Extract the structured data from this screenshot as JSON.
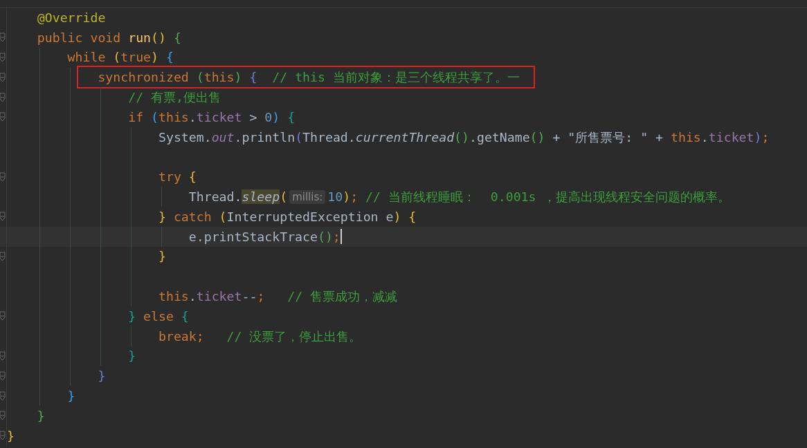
{
  "editor": {
    "lines": [
      {
        "kind": "code",
        "tokens": [
          {
            "text": "    @Override",
            "kind": "annotation"
          }
        ]
      },
      {
        "kind": "code",
        "fold": true,
        "tokens": [
          {
            "text": "    public void ",
            "kind": "keyword"
          },
          {
            "text": "run",
            "kind": "method"
          },
          {
            "text": "()",
            "kind": "bracket",
            "color": "#e8ba36"
          },
          {
            "text": " {",
            "kind": "bracket",
            "color": "#54a857"
          }
        ]
      },
      {
        "kind": "code",
        "fold": true,
        "tokens": [
          {
            "text": "        while ",
            "kind": "keyword"
          },
          {
            "text": "(",
            "kind": "bracket",
            "color": "#e8ba36"
          },
          {
            "text": "true",
            "kind": "keyword"
          },
          {
            "text": ")",
            "kind": "bracket",
            "color": "#e8ba36"
          },
          {
            "text": " {",
            "kind": "bracket",
            "color": "#359ff4"
          }
        ]
      },
      {
        "kind": "code",
        "fold": true,
        "boxed": true,
        "tokens": [
          {
            "text": "            synchronized ",
            "kind": "keyword"
          },
          {
            "text": "(",
            "kind": "bracket",
            "color": "#54a857"
          },
          {
            "text": "this",
            "kind": "keyword"
          },
          {
            "text": ")",
            "kind": "bracket",
            "color": "#54a857"
          },
          {
            "text": " {",
            "kind": "bracket",
            "color": "#6e7ed9"
          },
          {
            "text": "  // this 当前对象：是三个线程共享了。一",
            "kind": "comment"
          }
        ]
      },
      {
        "kind": "code",
        "fold": true,
        "tokens": [
          {
            "text": "                // 有票,便出售",
            "kind": "comment"
          }
        ]
      },
      {
        "kind": "code",
        "fold": true,
        "tokens": [
          {
            "text": "                if ",
            "kind": "keyword"
          },
          {
            "text": "(",
            "kind": "bracket",
            "color": "#359ff4"
          },
          {
            "text": "this",
            "kind": "keyword"
          },
          {
            "text": ".",
            "kind": "plain"
          },
          {
            "text": "ticket",
            "kind": "field"
          },
          {
            "text": " > ",
            "kind": "plain"
          },
          {
            "text": "0",
            "kind": "number"
          },
          {
            "text": ")",
            "kind": "bracket",
            "color": "#359ff4"
          },
          {
            "text": " {",
            "kind": "bracket",
            "color": "#1a9e94"
          }
        ]
      },
      {
        "kind": "code",
        "tokens": [
          {
            "text": "                    System.",
            "kind": "plain"
          },
          {
            "text": "out",
            "kind": "static-field"
          },
          {
            "text": ".println",
            "kind": "plain"
          },
          {
            "text": "(",
            "kind": "bracket",
            "color": "#6e7ed9"
          },
          {
            "text": "Thread.",
            "kind": "plain"
          },
          {
            "text": "currentThread",
            "kind": "static-method"
          },
          {
            "text": "()",
            "kind": "bracket",
            "color": "#54a857"
          },
          {
            "text": ".getName",
            "kind": "plain"
          },
          {
            "text": "()",
            "kind": "bracket",
            "color": "#54a857"
          },
          {
            "text": " + \"所售票号: \" + ",
            "kind": "plain"
          },
          {
            "text": "this",
            "kind": "keyword"
          },
          {
            "text": ".",
            "kind": "plain"
          },
          {
            "text": "ticket",
            "kind": "field"
          },
          {
            "text": ")",
            "kind": "bracket",
            "color": "#6e7ed9"
          },
          {
            "text": ";",
            "kind": "keyword"
          }
        ]
      },
      {
        "kind": "blank"
      },
      {
        "kind": "code",
        "fold": true,
        "tokens": [
          {
            "text": "                    try ",
            "kind": "keyword"
          },
          {
            "text": "{",
            "kind": "bracket",
            "color": "#e8ba36"
          }
        ]
      },
      {
        "kind": "code",
        "tokens": [
          {
            "text": "                        Thread.",
            "kind": "plain"
          },
          {
            "text": "sleep",
            "kind": "static-method",
            "highlighted": true
          },
          {
            "text": "(",
            "kind": "bracket",
            "color": "#e8ba36"
          },
          {
            "text": "millis:",
            "kind": "hint"
          },
          {
            "text": "10",
            "kind": "number"
          },
          {
            "text": ")",
            "kind": "bracket",
            "color": "#e8ba36"
          },
          {
            "text": ";",
            "kind": "keyword"
          },
          {
            "text": " // 当前线程睡眠：  0.001s ，提高出现线程安全问题的概率。",
            "kind": "comment"
          }
        ]
      },
      {
        "kind": "code",
        "fold": true,
        "tokens": [
          {
            "text": "                    }",
            "kind": "bracket",
            "color": "#e8ba36"
          },
          {
            "text": " catch ",
            "kind": "keyword"
          },
          {
            "text": "(",
            "kind": "bracket",
            "color": "#e8ba36"
          },
          {
            "text": "InterruptedException e",
            "kind": "plain"
          },
          {
            "text": ")",
            "kind": "bracket",
            "color": "#e8ba36"
          },
          {
            "text": " {",
            "kind": "bracket",
            "color": "#e8ba36"
          }
        ]
      },
      {
        "kind": "code",
        "current": true,
        "caret": true,
        "tokens": [
          {
            "text": "                        e.printStackTrace",
            "kind": "plain"
          },
          {
            "text": "()",
            "kind": "bracket",
            "color": "#54a857"
          },
          {
            "text": ";",
            "kind": "keyword"
          }
        ]
      },
      {
        "kind": "code",
        "fold": true,
        "tokens": [
          {
            "text": "                    }",
            "kind": "bracket",
            "color": "#e8ba36"
          }
        ]
      },
      {
        "kind": "blank"
      },
      {
        "kind": "code",
        "tokens": [
          {
            "text": "                    this",
            "kind": "keyword"
          },
          {
            "text": ".",
            "kind": "plain"
          },
          {
            "text": "ticket",
            "kind": "field"
          },
          {
            "text": "--",
            "kind": "plain"
          },
          {
            "text": ";",
            "kind": "keyword"
          },
          {
            "text": "   // 售票成功，减减",
            "kind": "comment"
          }
        ]
      },
      {
        "kind": "code",
        "fold": true,
        "tokens": [
          {
            "text": "                }",
            "kind": "bracket",
            "color": "#1a9e94"
          },
          {
            "text": " else ",
            "kind": "keyword"
          },
          {
            "text": "{",
            "kind": "bracket",
            "color": "#1a9e94"
          }
        ]
      },
      {
        "kind": "code",
        "tokens": [
          {
            "text": "                    break;",
            "kind": "keyword"
          },
          {
            "text": "   // 没票了，停止出售。",
            "kind": "comment"
          }
        ]
      },
      {
        "kind": "code",
        "fold": true,
        "tokens": [
          {
            "text": "                }",
            "kind": "bracket",
            "color": "#1a9e94"
          }
        ]
      },
      {
        "kind": "code",
        "fold": true,
        "tokens": [
          {
            "text": "            }",
            "kind": "bracket",
            "color": "#6e7ed9"
          }
        ]
      },
      {
        "kind": "code",
        "fold": true,
        "tokens": [
          {
            "text": "        }",
            "kind": "bracket",
            "color": "#359ff4"
          }
        ]
      },
      {
        "kind": "code",
        "fold": true,
        "tokens": [
          {
            "text": "    }",
            "kind": "bracket",
            "color": "#54a857"
          }
        ]
      },
      {
        "kind": "code",
        "fold": true,
        "tokens": [
          {
            "text": "}",
            "kind": "bracket",
            "color": "#e8ba36"
          }
        ]
      }
    ]
  }
}
